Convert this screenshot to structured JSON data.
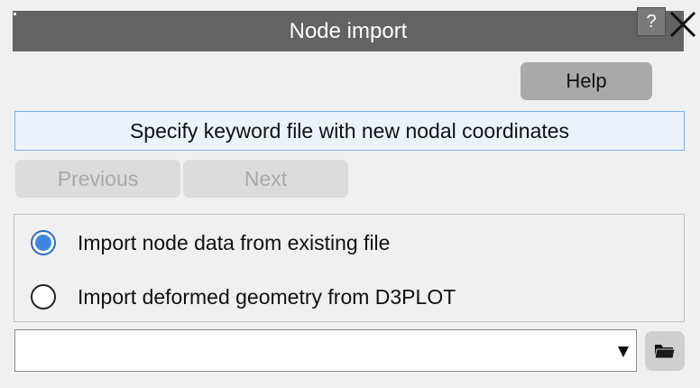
{
  "window": {
    "title": "Node import",
    "help_question_label": "?"
  },
  "toolbar": {
    "help_label": "Help"
  },
  "hint": {
    "text": "Specify keyword file with new nodal coordinates"
  },
  "navigation": {
    "previous_label": "Previous",
    "next_label": "Next",
    "previous_enabled": false,
    "next_enabled": false
  },
  "import_mode": {
    "options": [
      {
        "label": "Import node data from existing file",
        "selected": true
      },
      {
        "label": "Import deformed geometry from D3PLOT",
        "selected": false
      }
    ]
  },
  "file_select": {
    "value": ""
  },
  "icons": {
    "close": "close-icon",
    "dropdown": "dropdown-arrow-icon",
    "folder": "folder-icon"
  },
  "colors": {
    "titlebar": "#636363",
    "radio_accent": "#3d87e0",
    "hint_border": "#7aaee0"
  }
}
